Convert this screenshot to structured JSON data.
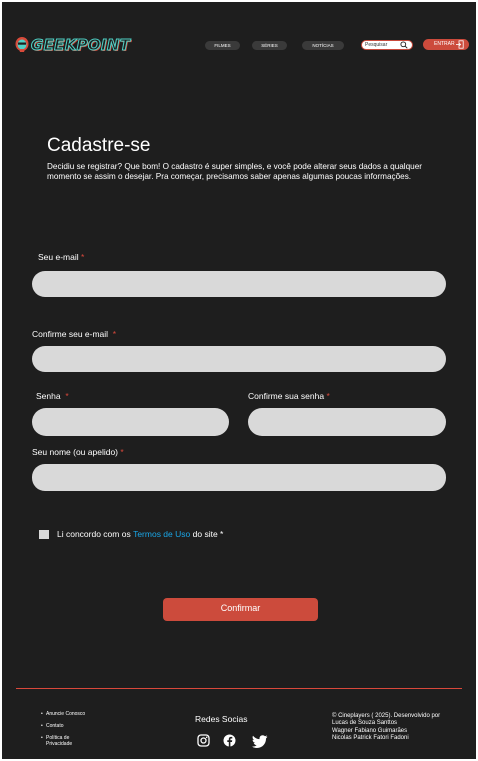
{
  "header": {
    "logo_text": "GEEKPOINT",
    "nav": [
      "FILMES",
      "SÉRIES",
      "NOTÍCIAS"
    ],
    "search_placeholder": "Pesquisar",
    "login_label": "ENTRAR"
  },
  "intro": {
    "title": "Cadastre-se",
    "subtitle": "Decidiu se registrar? Que bom! O cadastro é super simples, e você pode alterar seus dados a qualquer momento se assim o desejar. Pra começar, precisamos saber apenas algumas poucas informações."
  },
  "form": {
    "email_label": "Seu e-mail",
    "confirm_email_label": "Confirme seu e-mail",
    "password_label": "Senha",
    "confirm_password_label": "Confirme sua senha",
    "name_label": "Seu nome (ou apelido)",
    "required_mark": "*",
    "agree_prefix": "Li concordo com os",
    "terms_link": "Termos de Uso",
    "agree_suffix": "do site *",
    "submit_label": "Confirmar"
  },
  "footer": {
    "links": [
      "Anuncie Conosco",
      "Contato",
      "Política de Privacidade"
    ],
    "social_title": "Redes Socias",
    "social_icons": [
      "instagram-icon",
      "facebook-icon",
      "twitter-icon"
    ],
    "credits_lines": [
      "© Cineplayers ( 2025). Desenvolvido por",
      "Lucas de Souza Santtos",
      "Wagner Fabiano Guimarães",
      "Nicolas Patrick Fatori Fadoni"
    ]
  },
  "colors": {
    "background": "#1e1e1e",
    "accent": "#cc4b3c",
    "required": "#d9483b",
    "link": "#1aa7e8",
    "field": "#d9d9d9"
  }
}
